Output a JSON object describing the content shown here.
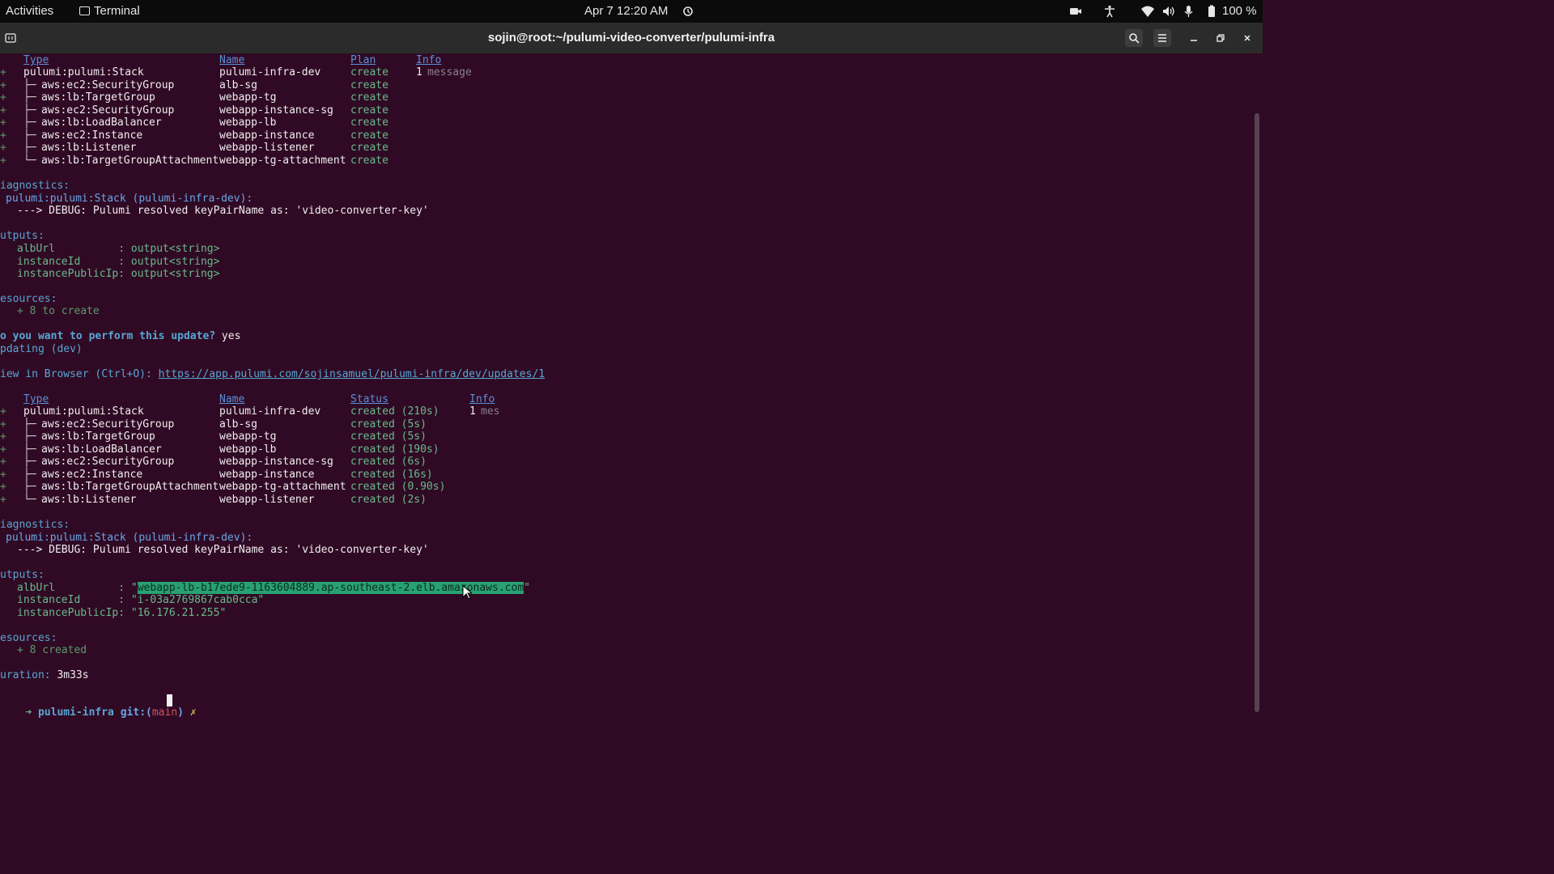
{
  "topbar": {
    "activities": "Activities",
    "app_name": "Terminal",
    "datetime": "Apr 7  12:20 AM",
    "battery": "100 %"
  },
  "window": {
    "title": "sojin@root:~/pulumi-video-converter/pulumi-infra"
  },
  "preview": {
    "headers": {
      "type": "Type",
      "name": "Name",
      "plan": "Plan",
      "info": "Info"
    },
    "rows": [
      {
        "prefix": "+",
        "tree": "",
        "type": "pulumi:pulumi:Stack",
        "name": "pulumi-infra-dev",
        "plan": "create",
        "info_num": "1",
        "info_text": "message"
      },
      {
        "prefix": "+",
        "tree": "├─",
        "type": "aws:ec2:SecurityGroup",
        "name": "alb-sg",
        "plan": "create"
      },
      {
        "prefix": "+",
        "tree": "├─",
        "type": "aws:lb:TargetGroup",
        "name": "webapp-tg",
        "plan": "create"
      },
      {
        "prefix": "+",
        "tree": "├─",
        "type": "aws:ec2:SecurityGroup",
        "name": "webapp-instance-sg",
        "plan": "create"
      },
      {
        "prefix": "+",
        "tree": "├─",
        "type": "aws:lb:LoadBalancer",
        "name": "webapp-lb",
        "plan": "create"
      },
      {
        "prefix": "+",
        "tree": "├─",
        "type": "aws:ec2:Instance",
        "name": "webapp-instance",
        "plan": "create"
      },
      {
        "prefix": "+",
        "tree": "├─",
        "type": "aws:lb:Listener",
        "name": "webapp-listener",
        "plan": "create"
      },
      {
        "prefix": "+",
        "tree": "└─",
        "type": "aws:lb:TargetGroupAttachment",
        "name": "webapp-tg-attachment",
        "plan": "create"
      }
    ],
    "diag_title": "iagnostics:",
    "diag_stack": "pulumi:pulumi:Stack (pulumi-infra-dev):",
    "diag_msg": "---> DEBUG: Pulumi resolved keyPairName as: 'video-converter-key'",
    "outputs_title": "utputs:",
    "outputs": [
      {
        "key": "albUrl          ",
        "val": ": output<string>"
      },
      {
        "key": "instanceId      ",
        "val": ": output<string>"
      },
      {
        "key": "instancePublicIp",
        "val": ": output<string>"
      }
    ],
    "resources_title": "esources:",
    "resources_line": "+ 8 to create",
    "question": "o you want to perform this update?",
    "answer": " yes",
    "updating": "pdating (dev)",
    "view_label": "iew in Browser (Ctrl+O): ",
    "view_url": "https://app.pulumi.com/sojinsamuel/pulumi-infra/dev/updates/1"
  },
  "update": {
    "headers": {
      "type": "Type",
      "name": "Name",
      "status": "Status",
      "info": "Info"
    },
    "rows": [
      {
        "prefix": "+",
        "tree": "",
        "type": "pulumi:pulumi:Stack",
        "name": "pulumi-infra-dev",
        "status": "created (210s)",
        "info_num": "1",
        "info_text": "mes"
      },
      {
        "prefix": "+",
        "tree": "├─",
        "type": "aws:ec2:SecurityGroup",
        "name": "alb-sg",
        "status": "created (5s)"
      },
      {
        "prefix": "+",
        "tree": "├─",
        "type": "aws:lb:TargetGroup",
        "name": "webapp-tg",
        "status": "created (5s)"
      },
      {
        "prefix": "+",
        "tree": "├─",
        "type": "aws:lb:LoadBalancer",
        "name": "webapp-lb",
        "status": "created (190s)"
      },
      {
        "prefix": "+",
        "tree": "├─",
        "type": "aws:ec2:SecurityGroup",
        "name": "webapp-instance-sg",
        "status": "created (6s)"
      },
      {
        "prefix": "+",
        "tree": "├─",
        "type": "aws:ec2:Instance",
        "name": "webapp-instance",
        "status": "created (16s)"
      },
      {
        "prefix": "+",
        "tree": "├─",
        "type": "aws:lb:TargetGroupAttachment",
        "name": "webapp-tg-attachment",
        "status": "created (0.90s)"
      },
      {
        "prefix": "+",
        "tree": "└─",
        "type": "aws:lb:Listener",
        "name": "webapp-listener",
        "status": "created (2s)"
      }
    ],
    "diag_title": "iagnostics:",
    "diag_stack": "pulumi:pulumi:Stack (pulumi-infra-dev):",
    "diag_msg": "---> DEBUG: Pulumi resolved keyPairName as: 'video-converter-key'",
    "outputs_title": "utputs:",
    "alb_key": "albUrl          ",
    "alb_sep": ": \"",
    "alb_val": "webapp-lb-b17ede9-1163604889.ap-southeast-2.elb.amazonaws.com",
    "alb_end": "\"",
    "instance_key": "instanceId      ",
    "instance_val": ": \"i-03a2769867cab0cca\"",
    "ip_key": "instancePublicIp",
    "ip_val": ": \"16.176.21.255\"",
    "resources_title": "esources:",
    "resources_line": "+ 8 created",
    "duration_label": "uration:",
    "duration_val": " 3m33s"
  },
  "prompt": {
    "arrow": "➜",
    "dir": "pulumi-infra",
    "git": "git:(",
    "branch": "main",
    "git_close": ")",
    "dirty": "✗"
  },
  "colors": {
    "terminal_bg": "#300a24",
    "heading_blue": "#5a8fd8",
    "highlight": "#27a173"
  }
}
